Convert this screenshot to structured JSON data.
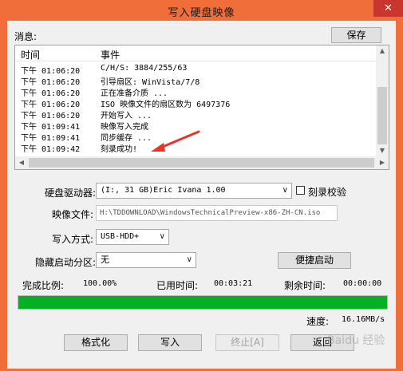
{
  "window": {
    "title": "写入硬盘映像",
    "close_glyph": "✕",
    "colors": {
      "frame": "#f06e3a",
      "close": "#c8362c",
      "arrow": "#e8342a",
      "progress": "#06b025"
    }
  },
  "messages": {
    "label": "消息:",
    "save_button": "保存",
    "columns": {
      "time": "时间",
      "event": "事件"
    },
    "rows": [
      {
        "time": "下午 01:06:20",
        "event": "C/H/S: 3884/255/63"
      },
      {
        "time": "下午 01:06:20",
        "event": "引导扇区: WinVista/7/8"
      },
      {
        "time": "下午 01:06:20",
        "event": "正在准备介质 ..."
      },
      {
        "time": "下午 01:06:20",
        "event": "ISO 映像文件的扇区数为 6497376"
      },
      {
        "time": "下午 01:06:20",
        "event": "开始写入 ..."
      },
      {
        "time": "下午 01:09:41",
        "event": "映像写入完成"
      },
      {
        "time": "下午 01:09:41",
        "event": "同步缓存 ..."
      },
      {
        "time": "下午 01:09:42",
        "event": "刻录成功!"
      }
    ],
    "scroll": {
      "up": "▲",
      "down": "▼",
      "left": "◀",
      "right": "▶"
    }
  },
  "form": {
    "drive_label": "硬盘驱动器:",
    "drive_value": "(I:, 31 GB)Eric    Ivana             1.00",
    "verify_label": "刻录校验",
    "verify_checked": false,
    "image_label": "映像文件:",
    "image_path": "H:\\TDDOWNLOAD\\WindowsTechnicalPreview-x86-ZH-CN.iso",
    "method_label": "写入方式:",
    "method_value": "USB-HDD+",
    "hidden_label": "隐藏启动分区:",
    "hidden_value": "无",
    "quick_boot_button": "便捷启动",
    "dropdown_arrow": "∨"
  },
  "status": {
    "complete_label": "完成比例:",
    "complete_value": "100.00%",
    "progress": 1.0,
    "elapsed_label": "已用时间:",
    "elapsed_value": "00:03:21",
    "remaining_label": "剩余时间:",
    "remaining_value": "00:00:00",
    "speed_label": "速度:",
    "speed_value": "16.16MB/s"
  },
  "buttons": {
    "format": "格式化",
    "write": "写入",
    "stop": "终止[A]",
    "back": "返回"
  },
  "watermark": "Baidu 经验"
}
